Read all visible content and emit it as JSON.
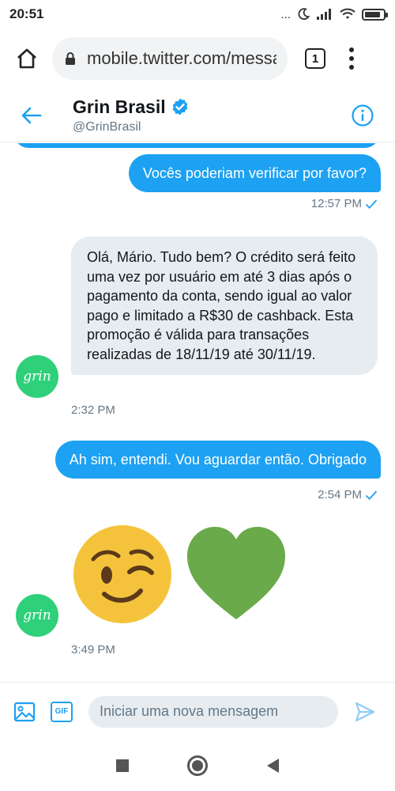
{
  "status_bar": {
    "time": "20:51",
    "dots": "...",
    "battery_level": 0.85
  },
  "browser": {
    "url": "mobile.twitter.com/messages",
    "tab_count": "1"
  },
  "chat_header": {
    "name": "Grin Brasil",
    "handle": "@GrinBrasil"
  },
  "avatar_text": "grin",
  "messages": [
    {
      "direction": "out",
      "text": "Vocês poderiam verificar por favor?",
      "time": "12:57 PM"
    },
    {
      "direction": "in",
      "text": "Olá, Mário. Tudo bem? O crédito será feito uma vez por usuário em até 3 dias após o pagamento da conta, sendo igual ao valor pago e limitado a R$30 de cashback. Esta promoção é válida para transações realizadas de 18/11/19 até 30/11/19.",
      "time": "2:32 PM"
    },
    {
      "direction": "out",
      "text": "Ah sim, entendi. Vou aguardar então. Obrigado",
      "time": "2:54 PM"
    },
    {
      "direction": "in",
      "emojis": [
        "winking-face",
        "green-heart"
      ],
      "time": "3:49 PM"
    }
  ],
  "composer": {
    "placeholder": "Iniciar uma nova mensagem",
    "gif_label": "GIF"
  },
  "colors": {
    "accent": "#1da1f2",
    "incoming_bubble": "#e6ecf0",
    "avatar": "#2fd07a",
    "heart": "#6aaa4a",
    "emoji": "#f5c33b"
  }
}
